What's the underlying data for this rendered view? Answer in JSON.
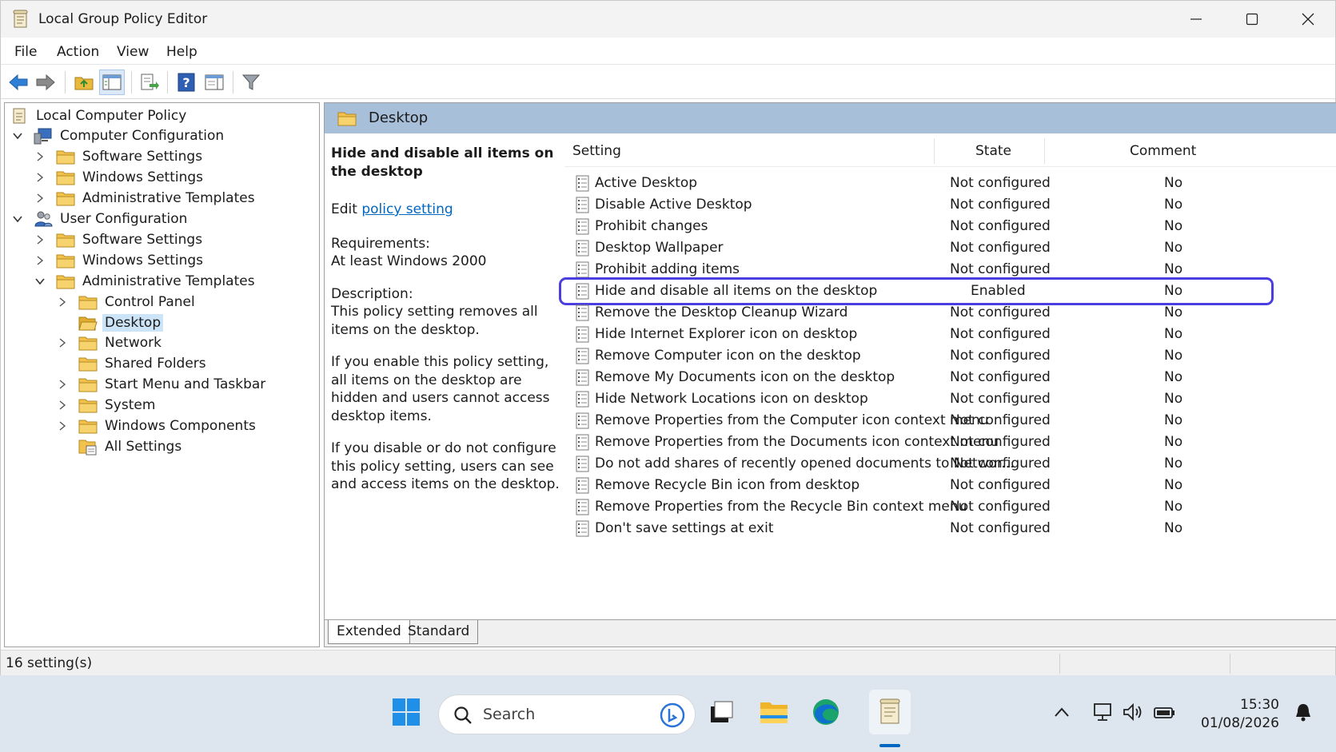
{
  "window": {
    "title": "Local Group Policy Editor"
  },
  "menu": [
    "File",
    "Action",
    "View",
    "Help"
  ],
  "tree": {
    "items": [
      {
        "label": "Local Computer Policy",
        "level": 0,
        "expander": "none",
        "icon": "policy-icon"
      },
      {
        "label": "Computer Configuration",
        "level": 1,
        "expander": "expanded",
        "icon": "computer-icon"
      },
      {
        "label": "Software Settings",
        "level": 2,
        "expander": "collapsed",
        "icon": "folder-icon"
      },
      {
        "label": "Windows Settings",
        "level": 2,
        "expander": "collapsed",
        "icon": "folder-icon"
      },
      {
        "label": "Administrative Templates",
        "level": 2,
        "expander": "collapsed",
        "icon": "folder-icon"
      },
      {
        "label": "User Configuration",
        "level": 1,
        "expander": "expanded",
        "icon": "users-icon"
      },
      {
        "label": "Software Settings",
        "level": 2,
        "expander": "collapsed",
        "icon": "folder-icon"
      },
      {
        "label": "Windows Settings",
        "level": 2,
        "expander": "collapsed",
        "icon": "folder-icon"
      },
      {
        "label": "Administrative Templates",
        "level": 2,
        "expander": "expanded",
        "icon": "folder-icon"
      },
      {
        "label": "Control Panel",
        "level": 3,
        "expander": "collapsed",
        "icon": "folder-icon"
      },
      {
        "label": "Desktop",
        "level": 3,
        "expander": "none",
        "icon": "folder-open-icon",
        "selected": true
      },
      {
        "label": "Network",
        "level": 3,
        "expander": "collapsed",
        "icon": "folder-icon"
      },
      {
        "label": "Shared Folders",
        "level": 3,
        "expander": "none",
        "icon": "folder-icon"
      },
      {
        "label": "Start Menu and Taskbar",
        "level": 3,
        "expander": "collapsed",
        "icon": "folder-icon"
      },
      {
        "label": "System",
        "level": 3,
        "expander": "collapsed",
        "icon": "folder-icon"
      },
      {
        "label": "Windows Components",
        "level": 3,
        "expander": "collapsed",
        "icon": "folder-icon"
      },
      {
        "label": "All Settings",
        "level": 3,
        "expander": "none",
        "icon": "all-settings-icon"
      }
    ]
  },
  "pane": {
    "title": "Desktop"
  },
  "description": {
    "title": "Hide and disable all items on the desktop",
    "edit_prefix": "Edit ",
    "edit_link": "policy setting",
    "requirements_label": "Requirements:",
    "requirements_value": "At least Windows 2000",
    "description_label": "Description:",
    "p1": "This policy setting removes all items on the desktop.",
    "p2": "If you enable this policy setting, all items on the desktop are hidden and users cannot access desktop items.",
    "p3": "If you disable or do not configure this policy setting, users can see and access items on the desktop."
  },
  "list": {
    "columns": {
      "setting": "Setting",
      "state": "State",
      "comment": "Comment"
    },
    "rows": [
      {
        "name": "Active Desktop",
        "state": "Not configured",
        "comment": "No"
      },
      {
        "name": "Disable Active Desktop",
        "state": "Not configured",
        "comment": "No"
      },
      {
        "name": "Prohibit changes",
        "state": "Not configured",
        "comment": "No"
      },
      {
        "name": "Desktop Wallpaper",
        "state": "Not configured",
        "comment": "No"
      },
      {
        "name": "Prohibit adding items",
        "state": "Not configured",
        "comment": "No"
      },
      {
        "name": "Hide and disable all items on the desktop",
        "state": "Enabled",
        "comment": "No",
        "highlighted": true
      },
      {
        "name": "Remove the Desktop Cleanup Wizard",
        "state": "Not configured",
        "comment": "No"
      },
      {
        "name": "Hide Internet Explorer icon on desktop",
        "state": "Not configured",
        "comment": "No"
      },
      {
        "name": "Remove Computer icon on the desktop",
        "state": "Not configured",
        "comment": "No"
      },
      {
        "name": "Remove My Documents icon on the desktop",
        "state": "Not configured",
        "comment": "No"
      },
      {
        "name": "Hide Network Locations icon on desktop",
        "state": "Not configured",
        "comment": "No"
      },
      {
        "name": "Remove Properties from the Computer icon context menu",
        "state": "Not configured",
        "comment": "No"
      },
      {
        "name": "Remove Properties from the Documents icon context menu",
        "state": "Not configured",
        "comment": "No"
      },
      {
        "name": "Do not add shares of recently opened documents to Networ...",
        "state": "Not configured",
        "comment": "No"
      },
      {
        "name": "Remove Recycle Bin icon from desktop",
        "state": "Not configured",
        "comment": "No"
      },
      {
        "name": "Remove Properties from the Recycle Bin context menu",
        "state": "Not configured",
        "comment": "No"
      },
      {
        "name": "Don't save settings at exit",
        "state": "Not configured",
        "comment": "No"
      }
    ]
  },
  "tabs": [
    "Extended",
    "Standard"
  ],
  "status": {
    "text": "16 setting(s)"
  },
  "taskbar": {
    "search_placeholder": "Search",
    "time": "15:30",
    "date": "01/08/2026"
  },
  "colors": {
    "accent": "#0067c0",
    "highlight_outline": "#4b3ee0",
    "pane_header": "#a7bfd9",
    "tree_selected": "#cce4f7"
  }
}
